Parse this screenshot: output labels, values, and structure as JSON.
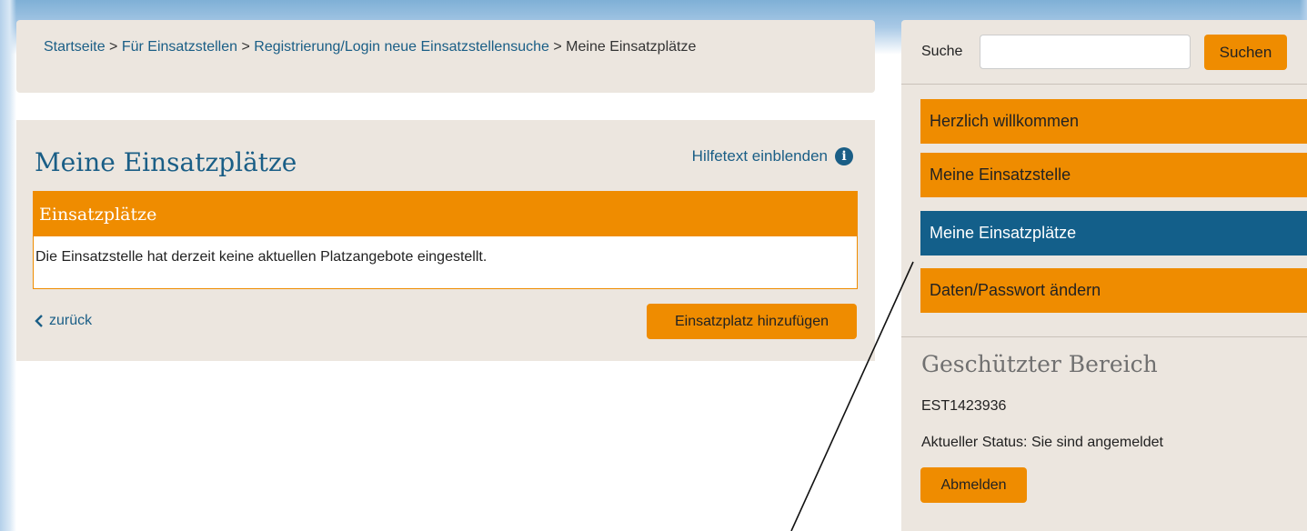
{
  "breadcrumb": {
    "items": [
      "Startseite",
      "Für Einsatzstellen",
      "Registrierung/Login neue Einsatzstellensuche",
      "Meine Einsatzplätze"
    ],
    "separator": ">"
  },
  "main": {
    "title": "Meine Einsatzplätze",
    "help_link": "Hilfetext einblenden",
    "box_header": "Einsatzplätze",
    "box_text": "Die Einsatzstelle hat derzeit keine aktuellen Platzangebote eingestellt.",
    "back_label": "zurück",
    "add_button": "Einsatzplatz hinzufügen"
  },
  "sidebar": {
    "search_label": "Suche",
    "search_value": "",
    "search_button": "Suchen",
    "nav": [
      {
        "label": "Herzlich willkommen",
        "active": false
      },
      {
        "label": "Meine Einsatzstelle",
        "active": false
      },
      {
        "label": "Meine Einsatzplätze",
        "active": true
      },
      {
        "label": "Daten/Passwort ändern",
        "active": false
      }
    ],
    "protected_title": "Geschützter Bereich",
    "est_id": "EST1423936",
    "status": "Aktueller Status: Sie sind angemeldet",
    "logout_button": "Abmelden"
  },
  "colors": {
    "accent_orange": "#ef8c00",
    "active_blue": "#135f8a",
    "link_blue": "#1a5e86",
    "panel_bg": "#ece6df"
  }
}
